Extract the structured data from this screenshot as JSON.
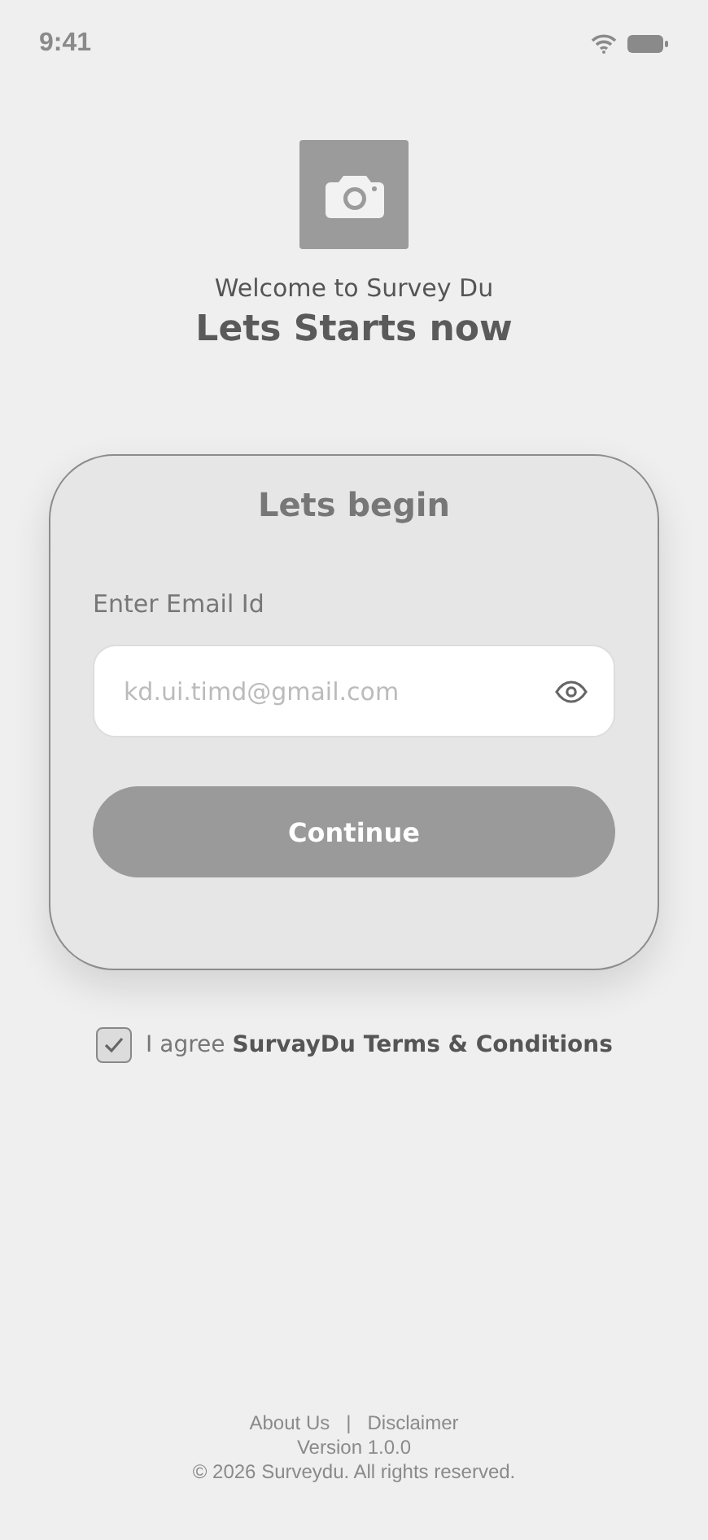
{
  "status_bar": {
    "time": "9:41"
  },
  "header": {
    "subtitle": "Welcome to Survey Du",
    "title": "Lets Starts now"
  },
  "card": {
    "title": "Lets begin",
    "email_label": "Enter Email Id",
    "email_field": {
      "placeholder": "kd.ui.timd@gmail.com"
    },
    "button": "Continue"
  },
  "agreement": {
    "checked": true,
    "text": "I agree **SurvayDu Terms & Conditions**"
  },
  "footer": {
    "links": [
      "About Us",
      "Disclaimer"
    ],
    "separator": "|",
    "version": "Version 1.0.0",
    "copyright": "© 2026 Surveydu. All rights reserved."
  }
}
